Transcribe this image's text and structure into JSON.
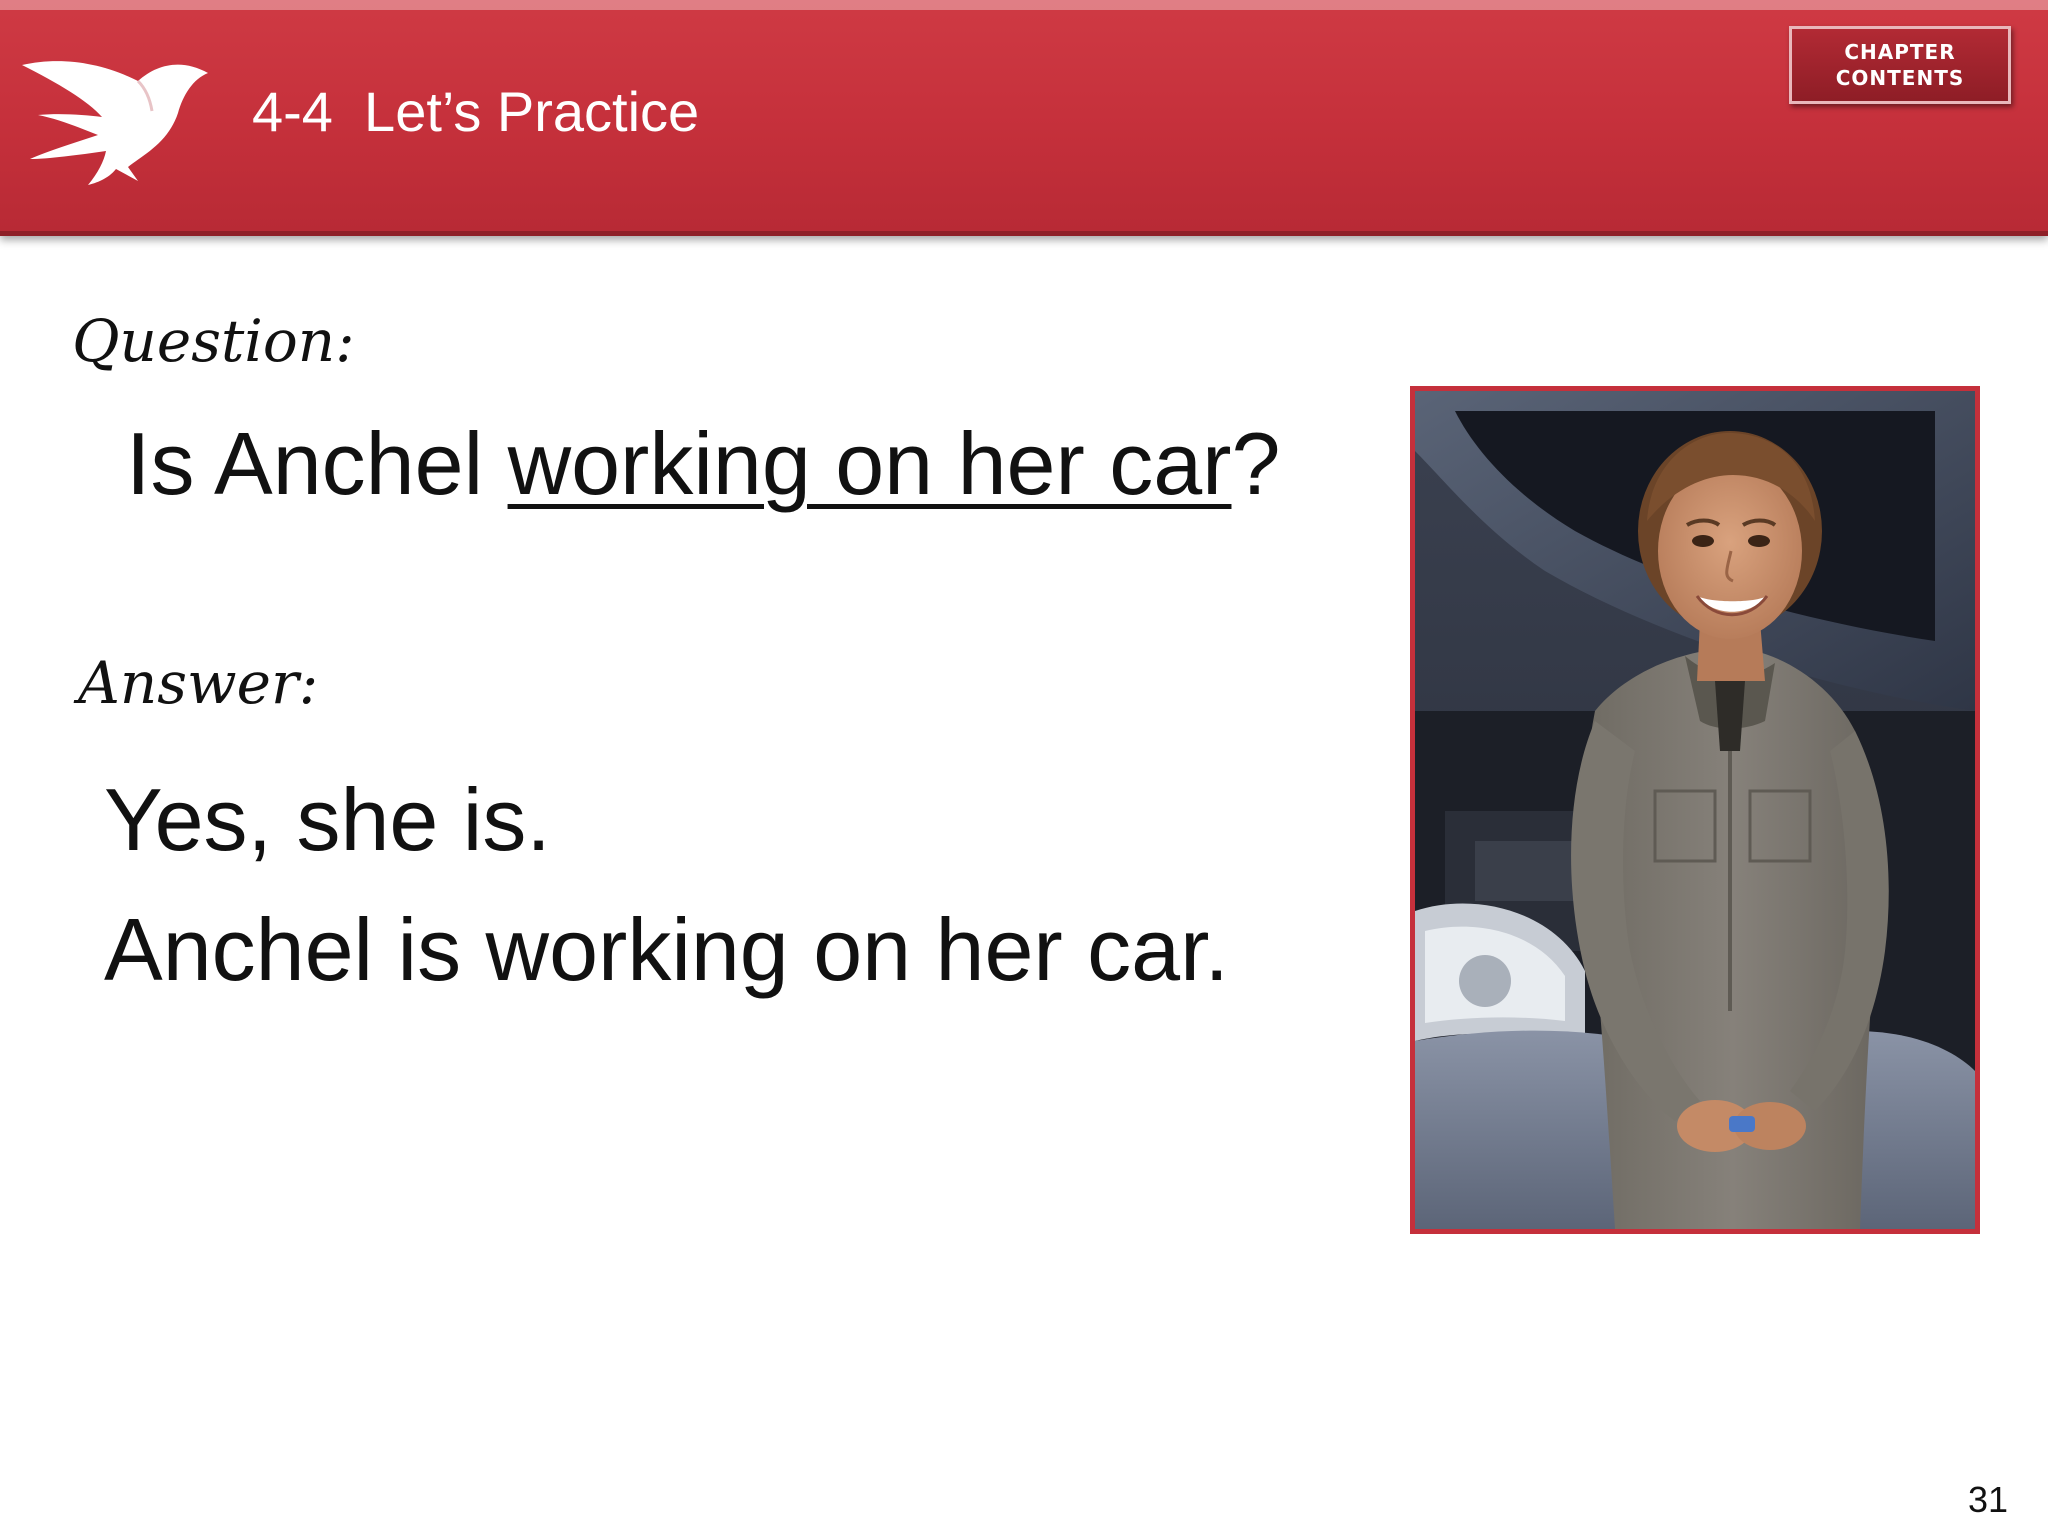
{
  "header": {
    "title": "4-4  Let’s Practice",
    "chapter_button": {
      "line1": "CHAPTER",
      "line2": "CONTENTS"
    }
  },
  "question": {
    "label": "Question:",
    "prefix": "Is Anchel ",
    "blank": "working on her car",
    "suffix": "?"
  },
  "answer": {
    "label": "Answer:",
    "line1": "Yes, she is.",
    "line2": "Anchel is working on her car."
  },
  "photo": {
    "subject": "woman-mechanic-in-coveralls-leaning-on-car"
  },
  "page_number": "31",
  "colors": {
    "banner": "#c5303b",
    "frame": "#c5303b",
    "text": "#111111"
  }
}
